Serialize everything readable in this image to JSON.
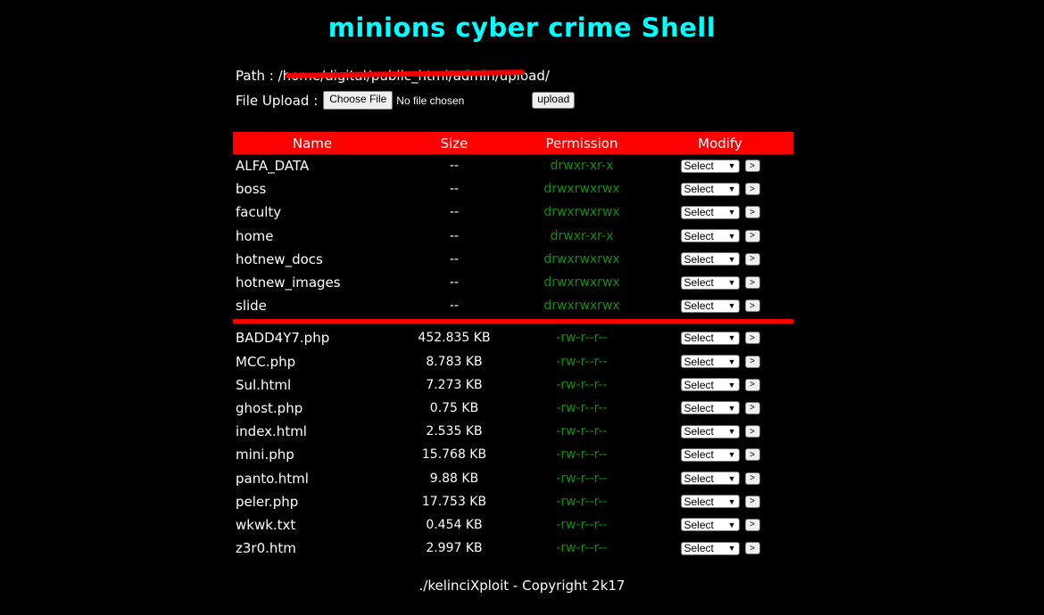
{
  "title": "minions cyber crime Shell",
  "path": {
    "label": "Path :",
    "value": "/home/digital/public_html/admin/upload/"
  },
  "upload": {
    "label": "File Upload :",
    "choose_button": "Choose File",
    "status": "No file chosen",
    "submit": "upload"
  },
  "table": {
    "headers": {
      "name": "Name",
      "size": "Size",
      "permission": "Permission",
      "modify": "Modify"
    },
    "select_label": "Select",
    "go_label": ">",
    "directories": [
      {
        "name": "ALFA_DATA",
        "size": "--",
        "perm": "drwxr-xr-x"
      },
      {
        "name": "boss",
        "size": "--",
        "perm": "drwxrwxrwx"
      },
      {
        "name": "faculty",
        "size": "--",
        "perm": "drwxrwxrwx"
      },
      {
        "name": "home",
        "size": "--",
        "perm": "drwxr-xr-x"
      },
      {
        "name": "hotnew_docs",
        "size": "--",
        "perm": "drwxrwxrwx"
      },
      {
        "name": "hotnew_images",
        "size": "--",
        "perm": "drwxrwxrwx"
      },
      {
        "name": "slide",
        "size": "--",
        "perm": "drwxrwxrwx"
      }
    ],
    "files": [
      {
        "name": "BADD4Y7.php",
        "size": "452.835 KB",
        "perm": "-rw-r--r--"
      },
      {
        "name": "MCC.php",
        "size": "8.783 KB",
        "perm": "-rw-r--r--"
      },
      {
        "name": "Sul.html",
        "size": "7.273 KB",
        "perm": "-rw-r--r--"
      },
      {
        "name": "ghost.php",
        "size": "0.75 KB",
        "perm": "-rw-r--r--"
      },
      {
        "name": "index.html",
        "size": "2.535 KB",
        "perm": "-rw-r--r--"
      },
      {
        "name": "mini.php",
        "size": "15.768 KB",
        "perm": "-rw-r--r--"
      },
      {
        "name": "panto.html",
        "size": "9.88 KB",
        "perm": "-rw-r--r--"
      },
      {
        "name": "peler.php",
        "size": "17.753 KB",
        "perm": "-rw-r--r--"
      },
      {
        "name": "wkwk.txt",
        "size": "0.454 KB",
        "perm": "-rw-r--r--"
      },
      {
        "name": "z3r0.htm",
        "size": "2.997 KB",
        "perm": "-rw-r--r--"
      }
    ]
  },
  "footer": "./kelinciXploit - Copyright 2k17",
  "colors": {
    "background": "#000000",
    "title": "#00ffff",
    "accent": "#ff0000",
    "permission": "#0f8f0f"
  }
}
